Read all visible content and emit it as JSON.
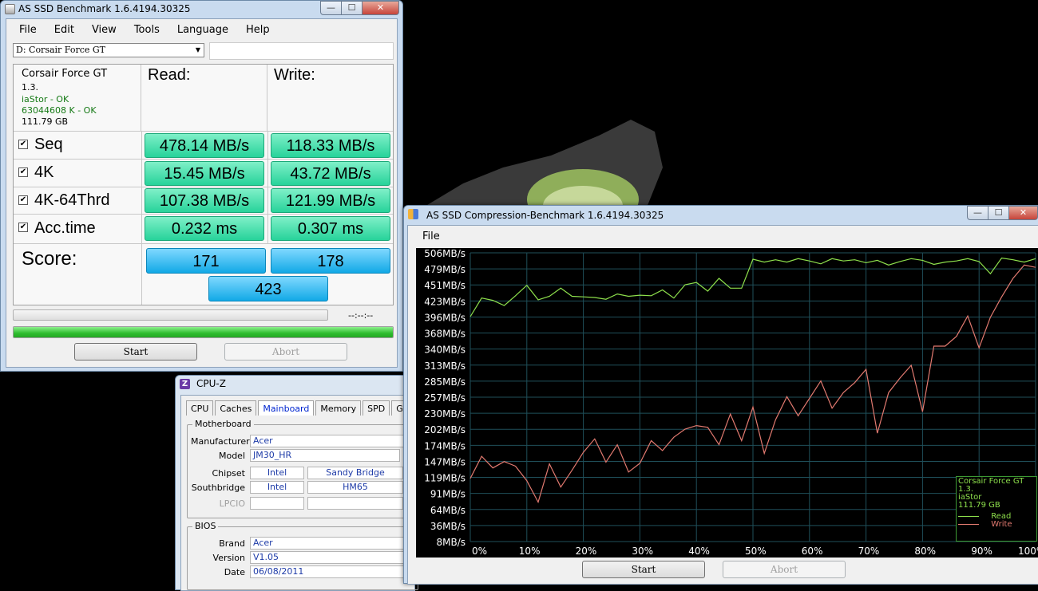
{
  "desktop": {
    "background": "#000000"
  },
  "asssd": {
    "title": "AS SSD Benchmark 1.6.4194.30325",
    "menu": [
      "File",
      "Edit",
      "View",
      "Tools",
      "Language",
      "Help"
    ],
    "drive_select": "D: Corsair Force GT",
    "info": {
      "model": "Corsair Force GT",
      "firmware": "1.3.",
      "driver": "iaStor - OK",
      "alignment": "63044608 K - OK",
      "size": "111.79 GB"
    },
    "col_read": "Read:",
    "col_write": "Write:",
    "rows": [
      {
        "label": "Seq",
        "read": "478.14 MB/s",
        "write": "118.33 MB/s"
      },
      {
        "label": "4K",
        "read": "15.45 MB/s",
        "write": "43.72 MB/s"
      },
      {
        "label": "4K-64Thrd",
        "read": "107.38 MB/s",
        "write": "121.99 MB/s"
      },
      {
        "label": "Acc.time",
        "read": "0.232 ms",
        "write": "0.307 ms"
      }
    ],
    "score_label": "Score:",
    "score_read": "171",
    "score_write": "178",
    "score_total": "423",
    "timer": "--:--:--",
    "progress_total": 1.0,
    "start": "Start",
    "abort": "Abort"
  },
  "cpuz": {
    "title": "CPU-Z",
    "tabs": [
      "CPU",
      "Caches",
      "Mainboard",
      "Memory",
      "SPD",
      "Graph"
    ],
    "active_tab": "Mainboard",
    "motherboard_label": "Motherboard",
    "manufacturer_label": "Manufacturer",
    "manufacturer": "Acer",
    "model_label": "Model",
    "model": "JM30_HR",
    "chipset_label": "Chipset",
    "chipset_vendor": "Intel",
    "chipset_name": "Sandy Bridge",
    "southbridge_label": "Southbridge",
    "southbridge_vendor": "Intel",
    "southbridge_name": "HM65",
    "lpcio_label": "LPCIO",
    "bios_label": "BIOS",
    "brand_label": "Brand",
    "brand": "Acer",
    "version_label": "Version",
    "version": "V1.05",
    "date_label": "Date",
    "date": "06/08/2011"
  },
  "compression": {
    "title": "AS SSD Compression-Benchmark 1.6.4194.30325",
    "menu": [
      "File"
    ],
    "start": "Start",
    "abort": "Abort",
    "legend": {
      "model": "Corsair Force GT",
      "firmware": "1.3.",
      "driver": "iaStor",
      "size": "111.79 GB",
      "read": "Read",
      "write": "Write"
    }
  },
  "chart_data": {
    "type": "line",
    "ylabels": [
      "506MB/s",
      "479MB/s",
      "451MB/s",
      "423MB/s",
      "396MB/s",
      "368MB/s",
      "340MB/s",
      "313MB/s",
      "285MB/s",
      "257MB/s",
      "230MB/s",
      "202MB/s",
      "174MB/s",
      "147MB/s",
      "119MB/s",
      "91MB/s",
      "64MB/s",
      "36MB/s",
      "8MB/s"
    ],
    "xlabels": [
      "0%",
      "10%",
      "20%",
      "30%",
      "40%",
      "50%",
      "60%",
      "70%",
      "80%",
      "90%",
      "100%"
    ],
    "xlim": [
      0,
      100
    ],
    "ylim": [
      8,
      506
    ],
    "grid": true,
    "legend_position": "bottom-right",
    "colors": {
      "read": "#8ee04c",
      "write": "#e27a70",
      "grid": "#1f4f5a"
    },
    "series": [
      {
        "name": "Read",
        "x": [
          0,
          2,
          4,
          6,
          8,
          10,
          12,
          14,
          16,
          18,
          20,
          22,
          24,
          26,
          28,
          30,
          32,
          34,
          36,
          38,
          40,
          42,
          44,
          46,
          48,
          50,
          52,
          54,
          56,
          58,
          60,
          62,
          64,
          66,
          68,
          70,
          72,
          74,
          76,
          78,
          80,
          82,
          84,
          86,
          88,
          90,
          92,
          94,
          96,
          98,
          100
        ],
        "values": [
          396,
          428,
          424,
          415,
          432,
          450,
          425,
          431,
          445,
          431,
          430,
          429,
          426,
          435,
          431,
          433,
          432,
          442,
          428,
          451,
          455,
          440,
          462,
          445,
          445,
          495,
          490,
          494,
          490,
          496,
          492,
          487,
          496,
          492,
          494,
          489,
          493,
          485,
          491,
          496,
          493,
          486,
          490,
          492,
          496,
          491,
          470,
          497,
          494,
          490,
          496
        ]
      },
      {
        "name": "Write",
        "x": [
          0,
          2,
          4,
          6,
          8,
          10,
          12,
          14,
          16,
          18,
          20,
          22,
          24,
          26,
          28,
          30,
          32,
          34,
          36,
          38,
          40,
          42,
          44,
          46,
          48,
          50,
          52,
          54,
          56,
          58,
          60,
          62,
          64,
          66,
          68,
          70,
          72,
          74,
          76,
          78,
          80,
          82,
          84,
          86,
          88,
          90,
          92,
          94,
          96,
          98,
          100
        ],
        "values": [
          117,
          155,
          135,
          146,
          138,
          113,
          76,
          142,
          102,
          131,
          162,
          185,
          145,
          175,
          128,
          143,
          182,
          165,
          188,
          202,
          208,
          205,
          175,
          228,
          182,
          240,
          160,
          218,
          258,
          225,
          255,
          285,
          238,
          265,
          282,
          305,
          195,
          265,
          290,
          312,
          232,
          345,
          345,
          362,
          397,
          342,
          395,
          430,
          462,
          485,
          481
        ]
      }
    ]
  }
}
